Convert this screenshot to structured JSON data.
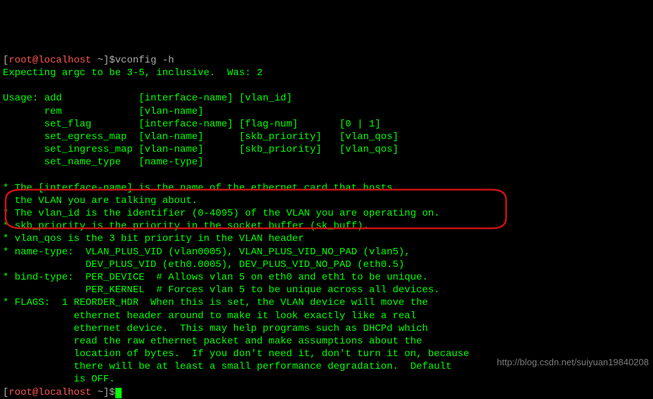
{
  "prompt": {
    "user_host": "root@localhost",
    "path": "~",
    "symbol_open": "[",
    "symbol_close": "]$",
    "command": "vconfig -h"
  },
  "error_line": "Expecting argc to be 3-5, inclusive.  Was: 2",
  "usage_header": "Usage:",
  "usage_rows": [
    {
      "cmd": "add",
      "args": "[interface-name] [vlan_id]"
    },
    {
      "cmd": "rem",
      "args": "[vlan-name]"
    },
    {
      "cmd": "set_flag",
      "args": "[interface-name] [flag-num]       [0 | 1]"
    },
    {
      "cmd": "set_egress_map",
      "args": "[vlan-name]      [skb_priority]   [vlan_qos]"
    },
    {
      "cmd": "set_ingress_map",
      "args": "[vlan-name]      [skb_priority]   [vlan_qos]"
    },
    {
      "cmd": "set_name_type",
      "args": "[name-type]"
    }
  ],
  "notes": {
    "iface_l1": "* The [interface-name] is the name of the ethernet card that hosts",
    "iface_l2": "  the VLAN you are talking about.",
    "vlan_id": "* The vlan_id is the identifier (0-4095) of the VLAN you are operating on.",
    "skb": "* skb_priority is the priority in the socket buffer (sk_buff).",
    "vlan_qos": "* vlan_qos is the 3 bit priority in the VLAN header",
    "name_type_l1": "* name-type:  VLAN_PLUS_VID (vlan0005), VLAN_PLUS_VID_NO_PAD (vlan5),",
    "name_type_l2": "              DEV_PLUS_VID (eth0.0005), DEV_PLUS_VID_NO_PAD (eth0.5)",
    "bind_l1": "* bind-type:  PER_DEVICE  # Allows vlan 5 on eth0 and eth1 to be unique.",
    "bind_l2": "              PER_KERNEL  # Forces vlan 5 to be unique across all devices.",
    "flags_l1": "* FLAGS:  1 REORDER_HDR  When this is set, the VLAN device will move the",
    "flags_l2": "            ethernet header around to make it look exactly like a real",
    "flags_l3": "            ethernet device.  This may help programs such as DHCPd which",
    "flags_l4": "            read the raw ethernet packet and make assumptions about the",
    "flags_l5": "            location of bytes.  If you don't need it, don't turn it on, because",
    "flags_l6": "            there will be at least a small performance degradation.  Default",
    "flags_l7": "            is OFF."
  },
  "watermark": "http://blog.csdn.net/suiyuan19840208"
}
